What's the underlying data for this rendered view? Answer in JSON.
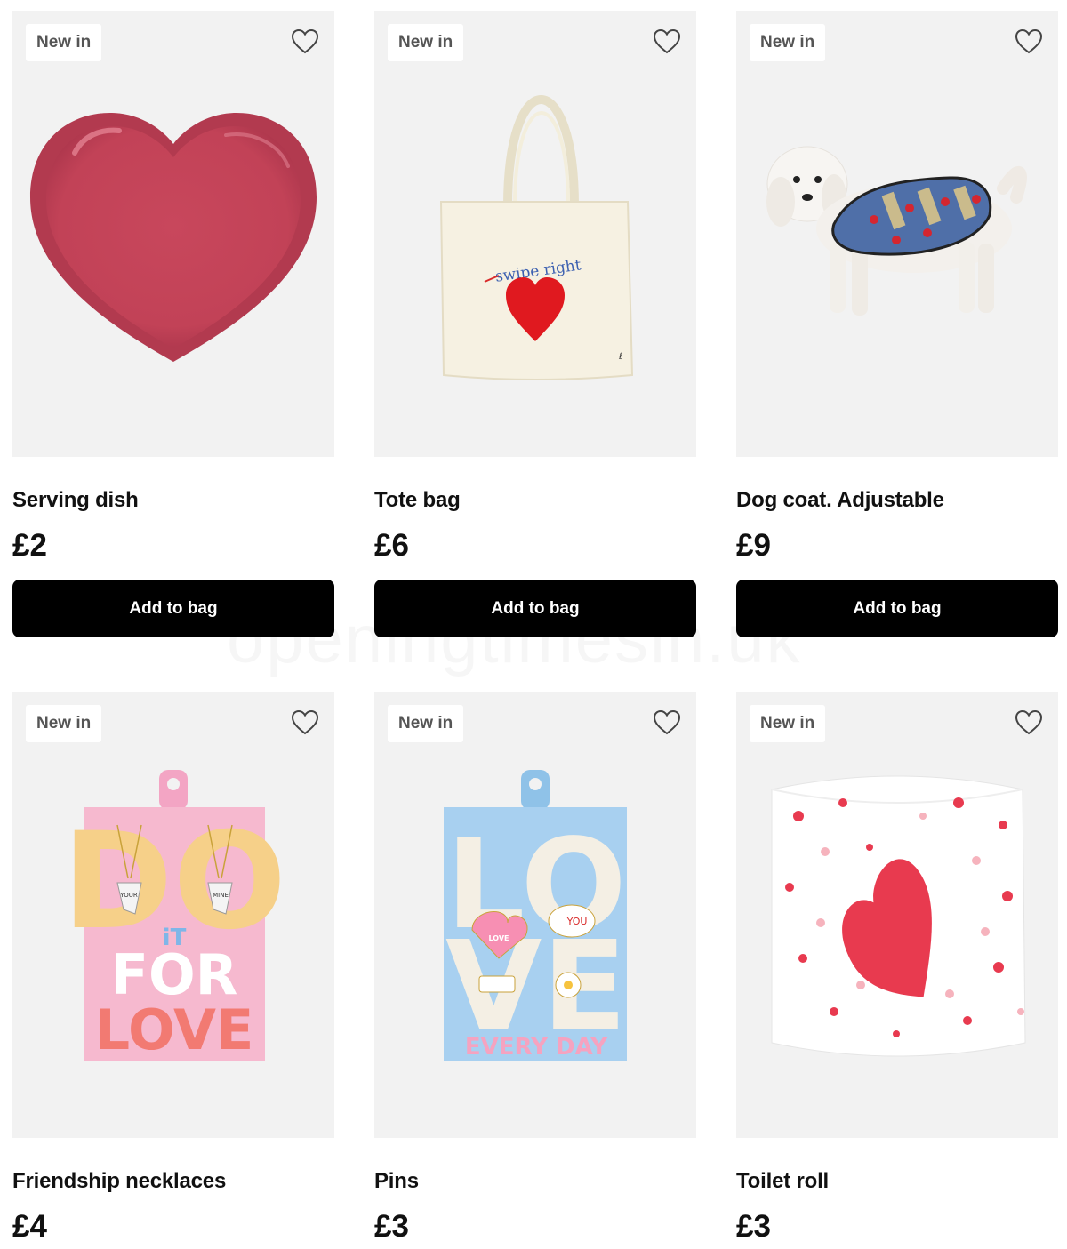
{
  "products": [
    {
      "badge": "New in",
      "name": "Serving dish",
      "price": "£2",
      "cta": "Add to bag"
    },
    {
      "badge": "New in",
      "name": "Tote bag",
      "price": "£6",
      "cta": "Add to bag"
    },
    {
      "badge": "New in",
      "name": "Dog coat. Adjustable",
      "price": "£9",
      "cta": "Add to bag"
    },
    {
      "badge": "New in",
      "name": "Friendship necklaces",
      "price": "£4"
    },
    {
      "badge": "New in",
      "name": "Pins",
      "price": "£3"
    },
    {
      "badge": "New in",
      "name": "Toilet roll",
      "price": "£3"
    }
  ],
  "art_text": {
    "tote_print": "swipe right",
    "necklace_card_big": "DO",
    "necklace_card_small": "iT",
    "necklace_card_for": "FOR",
    "necklace_card_love": "LOVE",
    "necklace_left_tag": "YOUR",
    "necklace_right_tag": "MINE",
    "pins_card_love_top": "LO",
    "pins_card_love_bottom": "VE",
    "pins_card_footer": "EVERY DAY",
    "pin_you": "YOU",
    "pin_love": "LOVE"
  },
  "watermark": "openingtimesin.uk",
  "icons": {
    "wishlist": "heart-outline-icon"
  },
  "colors": {
    "button_bg": "#000000",
    "button_text": "#ffffff",
    "tile_bg": "#f2f2f2",
    "badge_text": "#555555"
  }
}
